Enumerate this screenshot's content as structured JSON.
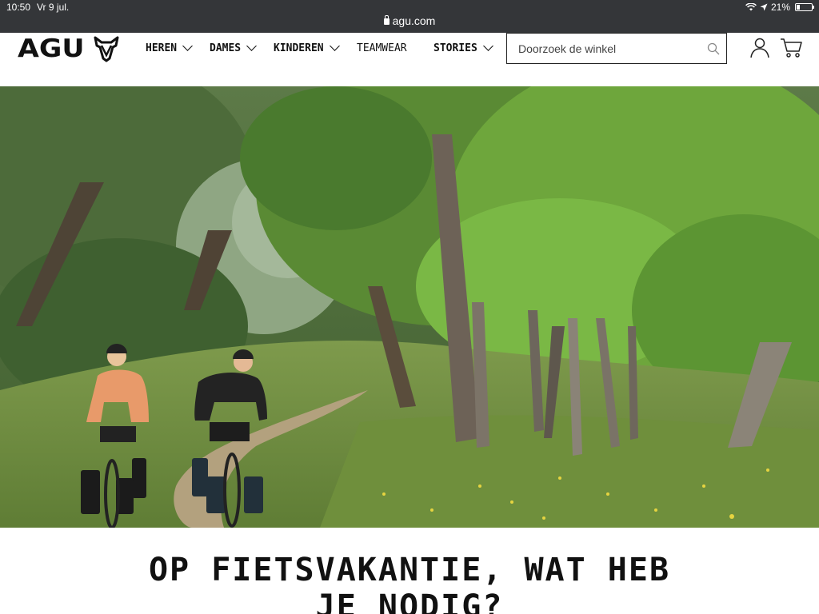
{
  "status_bar": {
    "time": "10:50",
    "date": "Vr 9 jul.",
    "battery": "21%",
    "battery_level": 0.21,
    "url": "agu.com"
  },
  "header": {
    "logo": "AGU",
    "nav": [
      {
        "label": "HEREN",
        "has_dropdown": true
      },
      {
        "label": "DAMES",
        "has_dropdown": true
      },
      {
        "label": "KINDEREN",
        "has_dropdown": true
      },
      {
        "label": "TEAMWEAR",
        "has_dropdown": false
      },
      {
        "label": "STORIES",
        "has_dropdown": true
      }
    ],
    "search_placeholder": "Doorzoek de winkel",
    "icons": [
      "search-icon",
      "account-icon",
      "cart-icon"
    ]
  },
  "hero": {
    "image": "two cyclists on bikes with panniers riding a dirt path through a green forest"
  },
  "main": {
    "headline": "OP FIETSVAKANTIE, WAT HEB JE NODIG?"
  },
  "colors": {
    "status_bar_bg": "#343639",
    "text": "#111111"
  }
}
